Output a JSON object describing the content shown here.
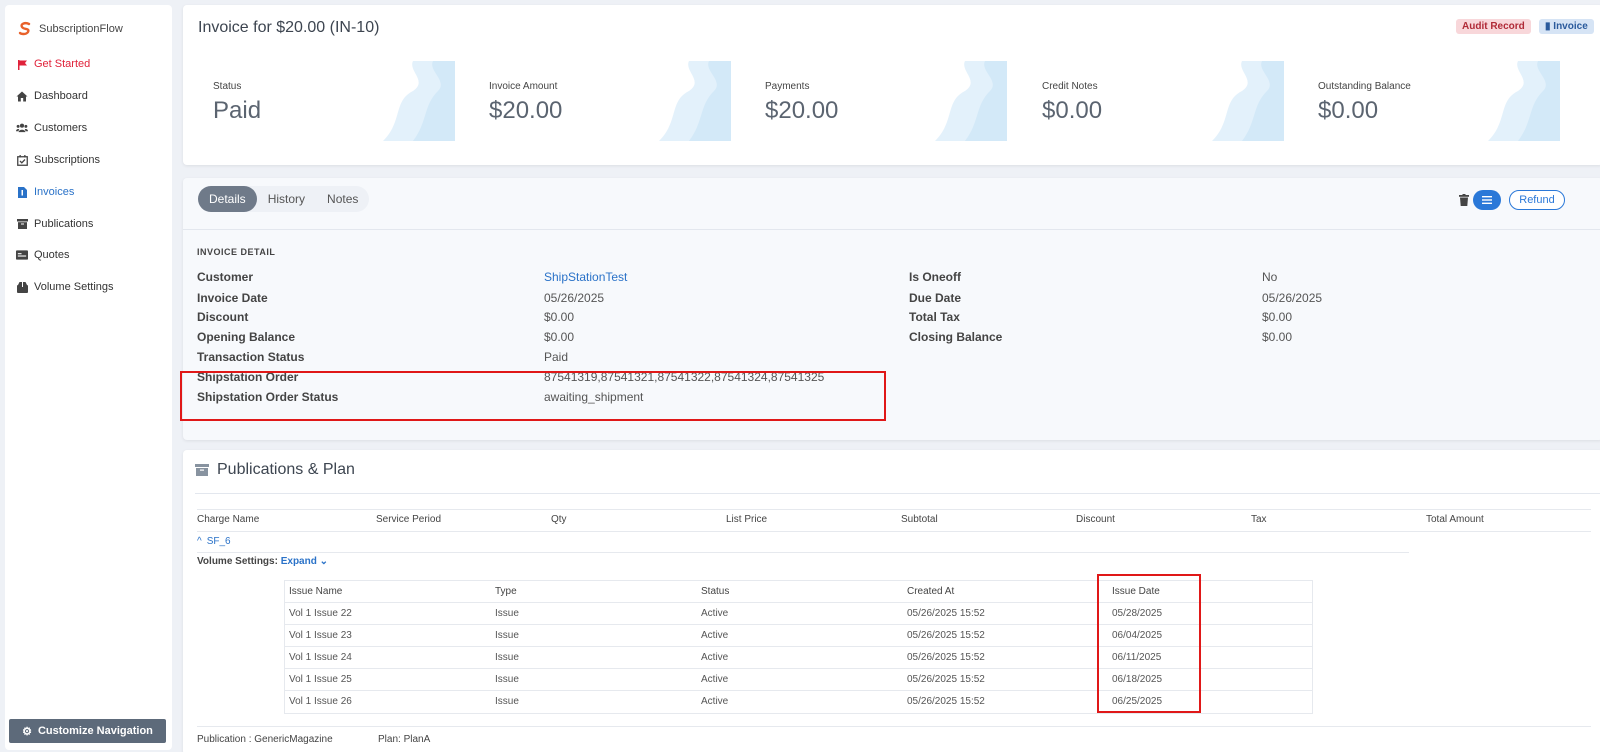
{
  "brand": {
    "name": "SubscriptionFlow",
    "color": "#e8612a"
  },
  "sidebar": {
    "items": [
      {
        "label": "Get Started",
        "icon": "flag-icon"
      },
      {
        "label": "Dashboard",
        "icon": "home-icon"
      },
      {
        "label": "Customers",
        "icon": "users-icon"
      },
      {
        "label": "Subscriptions",
        "icon": "calendar-check-icon"
      },
      {
        "label": "Invoices",
        "icon": "invoice-icon"
      },
      {
        "label": "Publications",
        "icon": "archive-icon"
      },
      {
        "label": "Quotes",
        "icon": "quote-icon"
      },
      {
        "label": "Volume Settings",
        "icon": "box-icon"
      }
    ],
    "customize_label": "Customize Navigation"
  },
  "header": {
    "title": "Invoice for $20.00 (IN-10)",
    "audit_label": "Audit Record",
    "invoice_label": "Invoice"
  },
  "stats": [
    {
      "label": "Status",
      "value": "Paid"
    },
    {
      "label": "Invoice Amount",
      "value": "$20.00"
    },
    {
      "label": "Payments",
      "value": "$20.00"
    },
    {
      "label": "Credit Notes",
      "value": "$0.00"
    },
    {
      "label": "Outstanding Balance",
      "value": "$0.00"
    }
  ],
  "tabs": [
    "Details",
    "History",
    "Notes"
  ],
  "refund_label": "Refund",
  "invoice_detail": {
    "heading": "INVOICE DETAIL",
    "left": [
      {
        "key": "Customer",
        "value": "ShipStationTest"
      },
      {
        "key": "Invoice Date",
        "value": "05/26/2025"
      },
      {
        "key": "Discount",
        "value": "$0.00"
      },
      {
        "key": "Opening Balance",
        "value": "$0.00"
      },
      {
        "key": "Transaction Status",
        "value": "Paid"
      },
      {
        "key": "Shipstation Order",
        "value": "87541319,87541321,87541322,87541324,87541325"
      },
      {
        "key": "Shipstation Order Status",
        "value": "awaiting_shipment"
      }
    ],
    "right": [
      {
        "key": "Is Oneoff",
        "value": "No"
      },
      {
        "key": "Due Date",
        "value": "05/26/2025"
      },
      {
        "key": "Total Tax",
        "value": "$0.00"
      },
      {
        "key": "Closing Balance",
        "value": "$0.00"
      }
    ]
  },
  "publications": {
    "title": "Publications & Plan",
    "columns": [
      "Charge Name",
      "Service Period",
      "Qty",
      "List Price",
      "Subtotal",
      "Discount",
      "Tax",
      "Total Amount"
    ],
    "charge": "SF_6",
    "volume_label": "Volume Settings:",
    "expand_label": "Expand",
    "issues_columns": [
      "Issue Name",
      "Type",
      "Status",
      "Created At",
      "Issue Date"
    ],
    "issues": [
      [
        "Vol 1 Issue 22",
        "Issue",
        "Active",
        "05/26/2025 15:52",
        "05/28/2025"
      ],
      [
        "Vol 1 Issue 23",
        "Issue",
        "Active",
        "05/26/2025 15:52",
        "06/04/2025"
      ],
      [
        "Vol 1 Issue 24",
        "Issue",
        "Active",
        "05/26/2025 15:52",
        "06/11/2025"
      ],
      [
        "Vol 1 Issue 25",
        "Issue",
        "Active",
        "05/26/2025 15:52",
        "06/18/2025"
      ],
      [
        "Vol 1 Issue 26",
        "Issue",
        "Active",
        "05/26/2025 15:52",
        "06/25/2025"
      ]
    ],
    "publication": "Publication : GenericMagazine",
    "plan": "Plan: PlanA"
  },
  "colors": {
    "accent": "#2a72c8",
    "highlight": "#e01818",
    "danger": "#e0223a"
  }
}
